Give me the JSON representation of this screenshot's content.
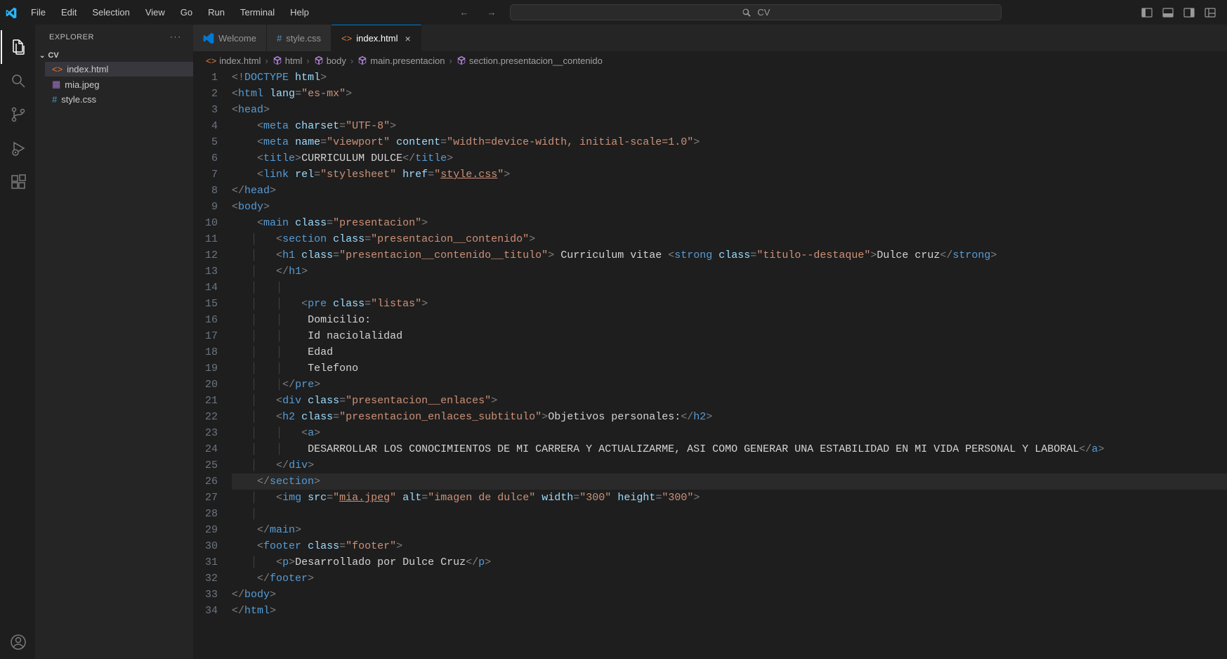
{
  "menu": {
    "items": [
      "File",
      "Edit",
      "Selection",
      "View",
      "Go",
      "Run",
      "Terminal",
      "Help"
    ]
  },
  "search": {
    "placeholder": "CV"
  },
  "sidebar": {
    "title": "EXPLORER",
    "folder": "CV",
    "files": [
      {
        "name": "index.html",
        "kind": "html",
        "selected": true
      },
      {
        "name": "mia.jpeg",
        "kind": "img",
        "selected": false
      },
      {
        "name": "style.css",
        "kind": "css",
        "selected": false
      }
    ]
  },
  "tabs": [
    {
      "label": "Welcome",
      "kind": "welcome",
      "active": false,
      "close": false
    },
    {
      "label": "style.css",
      "kind": "css",
      "active": false,
      "close": false
    },
    {
      "label": "index.html",
      "kind": "html",
      "active": true,
      "close": true
    }
  ],
  "breadcrumb": [
    {
      "icon": "html",
      "label": "index.html"
    },
    {
      "icon": "cube",
      "label": "html"
    },
    {
      "icon": "cube",
      "label": "body"
    },
    {
      "icon": "cube",
      "label": "main.presentacion"
    },
    {
      "icon": "cube",
      "label": "section.presentacion__contenido"
    }
  ],
  "lines": {
    "start": 1,
    "end": 34
  },
  "code": {
    "l5_viewport": "viewport",
    "l5_content": "width=device-width, initial-scale=1.0",
    "l6_title": "CURRICULUM DULCE",
    "l7_href": "style.css",
    "l10_class": "presentacion",
    "l11_class": "presentacion__contenido",
    "l12_class": "presentacion__contenido__titulo",
    "l12_text": " Curriculum vitae ",
    "l12_strong_class": "titulo--destaque",
    "l12_strong_text": "Dulce cruz",
    "l15_class": "listas",
    "l16": "Domicilio:",
    "l17": "Id naciolalidad",
    "l18": "Edad",
    "l19": "Telefono",
    "l21_class": "presentacion__enlaces",
    "l22_class": "presentacion_enlaces_subtitulo",
    "l22_text": "Objetivos personales:",
    "l24_text": "DESARROLLAR LOS CONOCIMIENTOS DE MI CARRERA Y ACTUALIZARME, ASI COMO GENERAR UNA ESTABILIDAD EN MI VIDA PERSONAL Y LABORAL",
    "l27_src": "mia.jpeg",
    "l27_alt": "imagen de dulce",
    "l27_w": "300",
    "l27_h": "300",
    "l30_class": "footer",
    "l31_text": "Desarrollado por Dulce Cruz"
  }
}
